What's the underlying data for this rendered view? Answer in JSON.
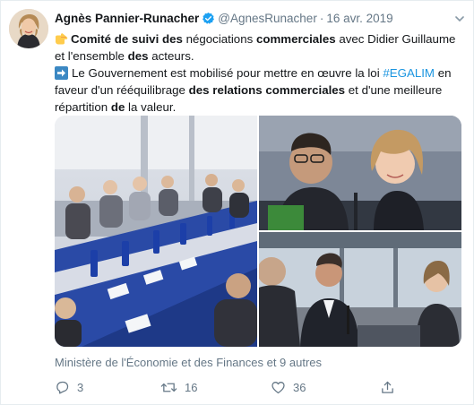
{
  "tweet": {
    "author_name": "Agnès Pannier-Runacher",
    "author_handle": "@AgnesRunacher",
    "separator": "·",
    "date": "16 avr. 2019",
    "line1": {
      "bold1": "Comité de suivi des",
      "text1": " négociations ",
      "bold2": "commerciales",
      "text2": " avec Didier Guillaume et l'ensemble ",
      "bold3": "des",
      "text3": " acteurs."
    },
    "line2": {
      "text1": "Le Gouvernement est mobilisé pour mettre en œuvre la loi ",
      "hashtag": "#EGALIM",
      "text2": " en faveur d'un rééquilibrage ",
      "bold1": "des relations commerciales",
      "text3": " et d'une meilleure répartition ",
      "bold2": "de",
      "text4": " la valeur."
    },
    "context": "Ministère de l'Économie et des Finances et 9 autres",
    "counts": {
      "replies": "3",
      "retweets": "16",
      "likes": "36"
    }
  },
  "icons": {
    "verified": "verified-badge-icon",
    "chevron": "chevron-down-icon",
    "pointing_hand": "backhand-index-pointing-right-emoji",
    "arrow": "right-arrow-emoji",
    "reply": "reply-icon",
    "retweet": "retweet-icon",
    "like": "heart-icon",
    "share": "share-icon"
  },
  "colors": {
    "text": "#14171a",
    "secondary": "#657786",
    "link": "#1b95e0",
    "verified": "#1da1f2"
  }
}
